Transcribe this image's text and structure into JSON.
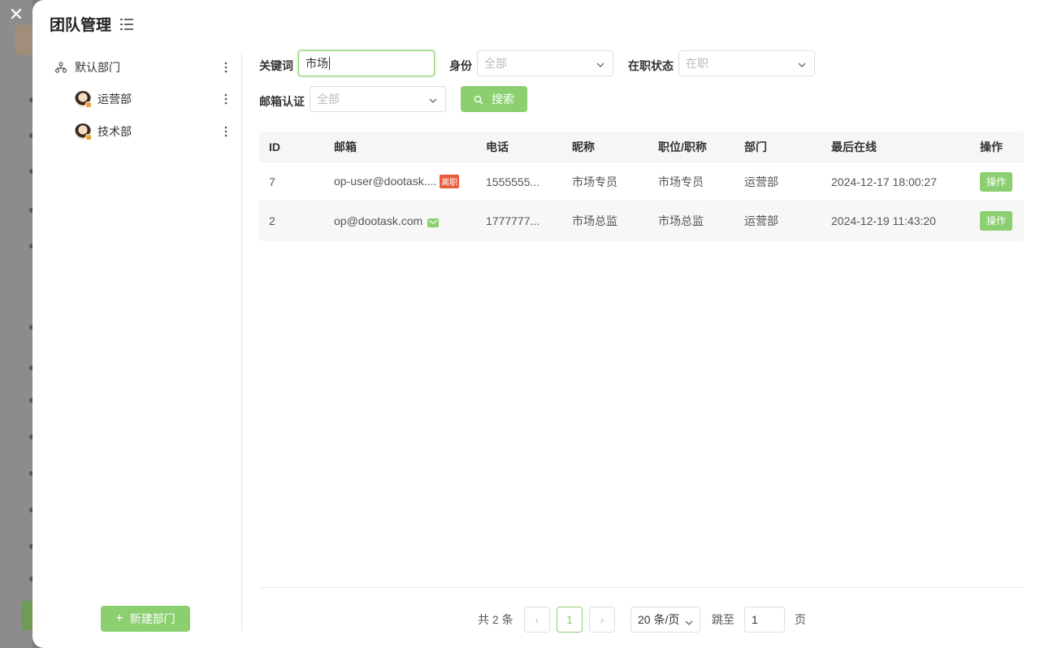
{
  "modal": {
    "title": "团队管理",
    "close_symbol": "✕"
  },
  "sidebar": {
    "root": {
      "label": "默认部门"
    },
    "items": [
      {
        "label": "运营部"
      },
      {
        "label": "技术部"
      }
    ],
    "new_dept_label": "新建部门"
  },
  "filters": {
    "keyword_label": "关键词",
    "keyword_value": "市场",
    "role_label": "身份",
    "role_value": "全部",
    "status_label": "在职状态",
    "status_value": "在职",
    "email_verify_label": "邮箱认证",
    "email_verify_value": "全部",
    "search_label": "搜索"
  },
  "table": {
    "headers": [
      "ID",
      "邮箱",
      "电话",
      "昵称",
      "职位/职称",
      "部门",
      "最后在线",
      "操作"
    ],
    "rows": [
      {
        "id": "7",
        "email": "op-user@dootask....",
        "email_badge": "离职",
        "phone": "1555555...",
        "nickname": "市场专员",
        "title": "市场专员",
        "dept": "运营部",
        "last_online": "2024-12-17 18:00:27",
        "op": "操作"
      },
      {
        "id": "2",
        "email": "op@dootask.com",
        "email_badge": "",
        "phone": "1777777...",
        "nickname": "市场总监",
        "title": "市场总监",
        "dept": "运营部",
        "last_online": "2024-12-19 11:43:20",
        "op": "操作"
      }
    ]
  },
  "pagination": {
    "total_text": "共 2 条",
    "current_page": "1",
    "page_size": "20 条/页",
    "jump_label": "跳至",
    "jump_value": "1",
    "page_word": "页",
    "prev_symbol": "‹",
    "next_symbol": "›"
  },
  "colors": {
    "accent": "#8bcf70",
    "left_badge": "#e85d3a"
  }
}
